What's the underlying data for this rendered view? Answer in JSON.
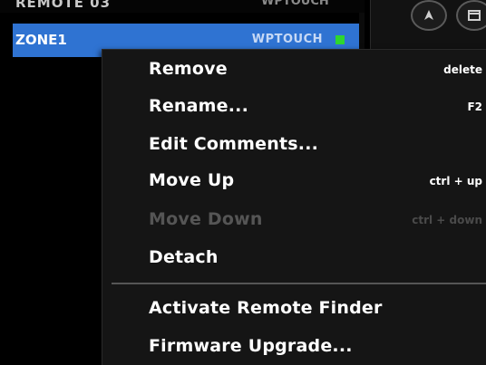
{
  "list": {
    "previous_row": {
      "name": "REMOTE 03",
      "type": "WPTOUCH"
    },
    "selected_row": {
      "name": "ZONE1",
      "type": "WPTOUCH",
      "status_color": "#2ed62e"
    }
  },
  "toolbar": {
    "icons": [
      "navigate-icon",
      "window-icon"
    ]
  },
  "context_menu": {
    "items": [
      {
        "label": "Remove",
        "shortcut": "delete",
        "enabled": true
      },
      {
        "label": "Rename...",
        "shortcut": "F2",
        "enabled": true
      },
      {
        "label": "Edit Comments...",
        "shortcut": "",
        "enabled": true
      },
      {
        "label": "Move Up",
        "shortcut": "ctrl + up",
        "enabled": true
      },
      {
        "label": "Move Down",
        "shortcut": "ctrl + down",
        "enabled": false
      },
      {
        "label": "Detach",
        "shortcut": "",
        "enabled": true
      },
      {
        "label": "Activate Remote Finder",
        "shortcut": "",
        "enabled": true
      },
      {
        "label": "Firmware Upgrade...",
        "shortcut": "",
        "enabled": true
      }
    ]
  },
  "colors": {
    "selection": "#2f73d2",
    "menu_background": "#151515",
    "disabled_text": "#555555"
  }
}
